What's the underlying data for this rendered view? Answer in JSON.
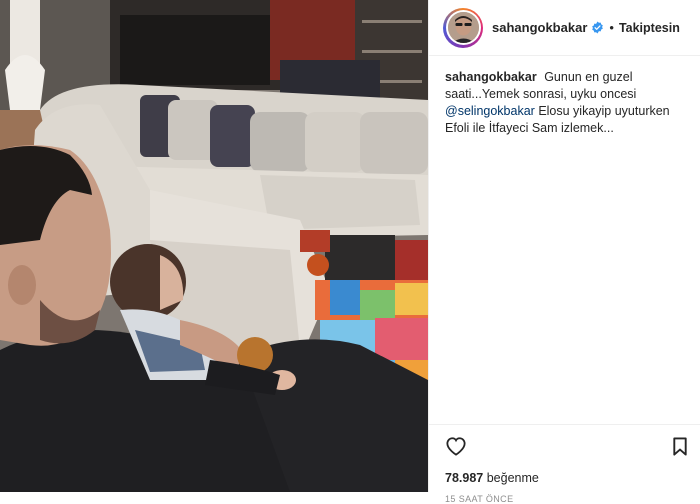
{
  "post": {
    "photo_name": "post-photo",
    "username": "sahangokbakar",
    "separator": "•",
    "follow_label": "Takiptesin",
    "caption": {
      "username": "sahangokbakar",
      "text_before": "Gunun en guzel saati...Yemek sonrasi, uyku oncesi",
      "mention": "@selingokbakar",
      "text_after": "Elosu yikayip uyuturken Efoli ile İtfayeci Sam izlemek..."
    },
    "likes_count": "78.987",
    "likes_label": "beğenme",
    "timestamp": "15 SAAT ÖNCE"
  },
  "icons": {
    "like": "heart-icon",
    "save": "bookmark-icon",
    "verified": "verified-badge-icon"
  },
  "colors": {
    "mention": "#003569",
    "verified": "#3897f0",
    "muted": "#8e8e8e",
    "text": "#262626"
  }
}
